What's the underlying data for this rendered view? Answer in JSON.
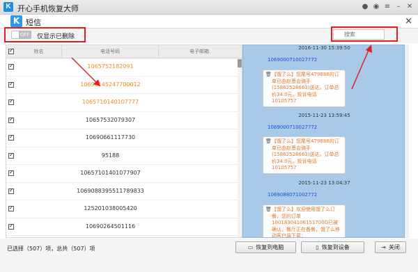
{
  "app": {
    "title": "开心手机恢复大师",
    "logo_letter": "K"
  },
  "panel": {
    "title": "短信",
    "logo_letter": "K"
  },
  "filter": {
    "toggle_label": "OFF",
    "label": "仅显示已删除"
  },
  "search": {
    "placeholder": "搜索"
  },
  "table": {
    "columns": [
      "姓名",
      "电话号码",
      "电子邮箱"
    ],
    "rows": [
      {
        "phone": "1065752182091",
        "highlight": true
      },
      {
        "phone": "10690145247700012",
        "highlight": true
      },
      {
        "phone": "1065710140107777",
        "highlight": true
      },
      {
        "phone": "10657532079307",
        "highlight": false
      },
      {
        "phone": "10690661117730",
        "highlight": false
      },
      {
        "phone": "95188",
        "highlight": false
      },
      {
        "phone": "10657101401077907",
        "highlight": false
      },
      {
        "phone": "1069088395511789833",
        "highlight": false
      },
      {
        "phone": "125201038005420",
        "highlight": false
      },
      {
        "phone": "10690264501116",
        "highlight": false
      }
    ]
  },
  "messages": [
    {
      "time": "2016-11-30 15:39:50",
      "sender": "1069000710027772",
      "text": "【饿了么】您尾号479886的订单已由赵恩会骑手(15862528663)送达，订单总价34.0元，投诉电话 10105757"
    },
    {
      "time": "2015-11-23 13:59:45",
      "sender": "1069000710027772",
      "text": "【饿了么】您尾号479886的订单已由赵恩会骑手(15862528663)送达，订单总价34.0元，投诉电话 10105757"
    },
    {
      "time": "2015-11-23 13:04:37",
      "sender": "1069088071002772",
      "text": "【饿了么】欢迎使用饿了么订餐，您的订单10018304106151700G已被确认，餐厅正在备餐，饿了么移动客户端下载：http://m.ele.me/dapp"
    }
  ],
  "status": {
    "text": "已选择（507）项，总共（507）项"
  },
  "buttons": {
    "restore_pc": "恢复到电脑",
    "restore_device": "恢复到设备",
    "close": "关闭"
  },
  "colors": {
    "accent": "#2b9be6",
    "highlight_text": "#ef8b1f",
    "annotation_red": "#e02020",
    "message_bg": "#a8cae8",
    "sender_blue": "#1d4fd6"
  }
}
